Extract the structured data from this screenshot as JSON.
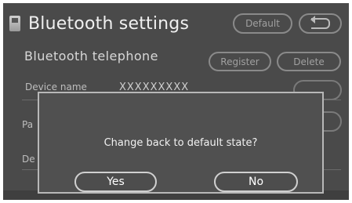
{
  "header": {
    "title": "Bluetooth settings",
    "default_label": "Default",
    "back_icon": "back-arrow-icon"
  },
  "section": {
    "label": "Bluetooth telephone",
    "register_label": "Register",
    "delete_label": "Delete"
  },
  "device": {
    "name_label": "Device name",
    "name_value": "XXXXXXXXX"
  },
  "partial_rows": [
    "Pa",
    "De"
  ],
  "dialog": {
    "message": "Change back to default state?",
    "yes_label": "Yes",
    "no_label": "No"
  }
}
